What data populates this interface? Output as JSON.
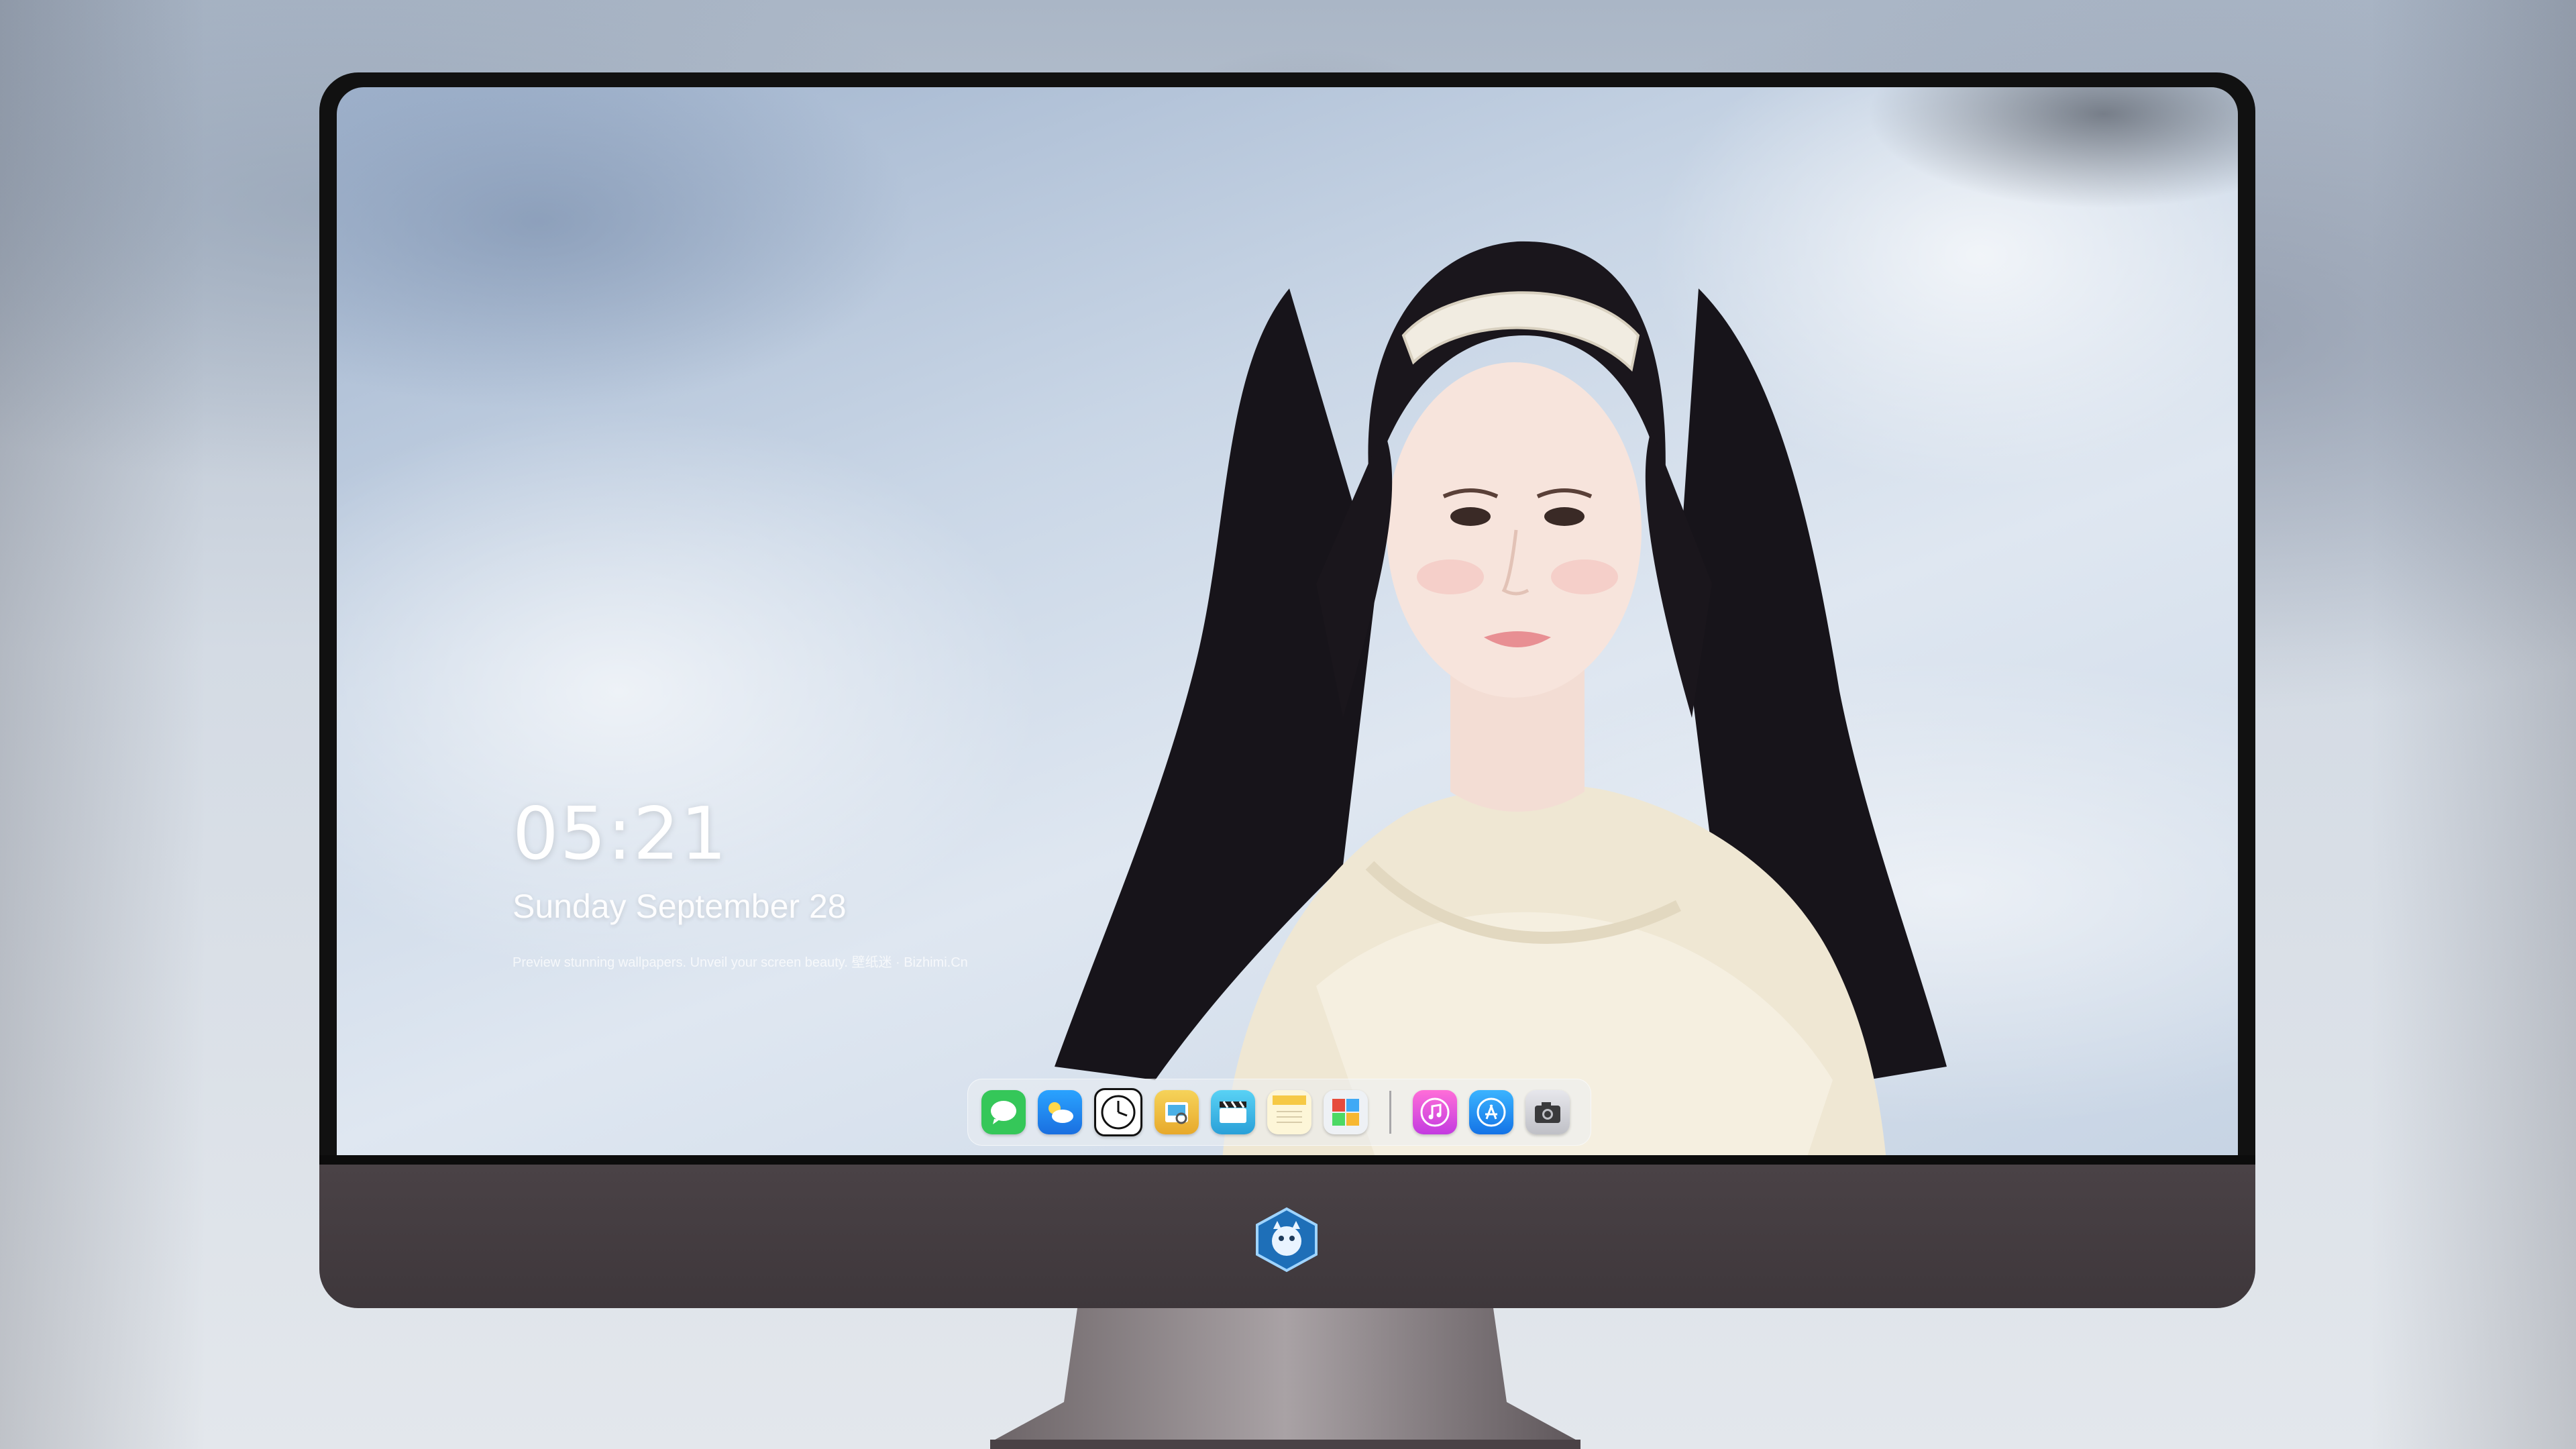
{
  "lockscreen": {
    "time": "05:21",
    "date": "Sunday September 28",
    "tagline": "Preview stunning wallpapers. Unveil your screen beauty. 壁纸迷 · Bizhimi.Cn"
  },
  "dock": {
    "apps": [
      {
        "name": "Messages",
        "icon": "messages-icon",
        "color": "#35c759"
      },
      {
        "name": "Weather",
        "icon": "weather-icon",
        "color": "#2f8cf0"
      },
      {
        "name": "Clock",
        "icon": "clock-icon",
        "color": "#111111"
      },
      {
        "name": "Preview",
        "icon": "preview-icon",
        "color": "#f0c23a"
      },
      {
        "name": "Clips",
        "icon": "clips-icon",
        "color": "#3ab8e8"
      },
      {
        "name": "Notes",
        "icon": "notes-icon",
        "color": "#f6d44a"
      },
      {
        "name": "Photo Booth",
        "icon": "photo-booth-icon",
        "color": "#e9ecf0"
      },
      {
        "name": "iTunes",
        "icon": "itunes-icon",
        "color": "#e94fb8"
      },
      {
        "name": "App Store",
        "icon": "app-store-icon",
        "color": "#1f8df5"
      },
      {
        "name": "Camera",
        "icon": "camera-icon",
        "color": "#d9d9de"
      }
    ]
  },
  "colors": {
    "bezel": "#111111",
    "chin": "#443c40",
    "lock_text": "#ffffff"
  }
}
